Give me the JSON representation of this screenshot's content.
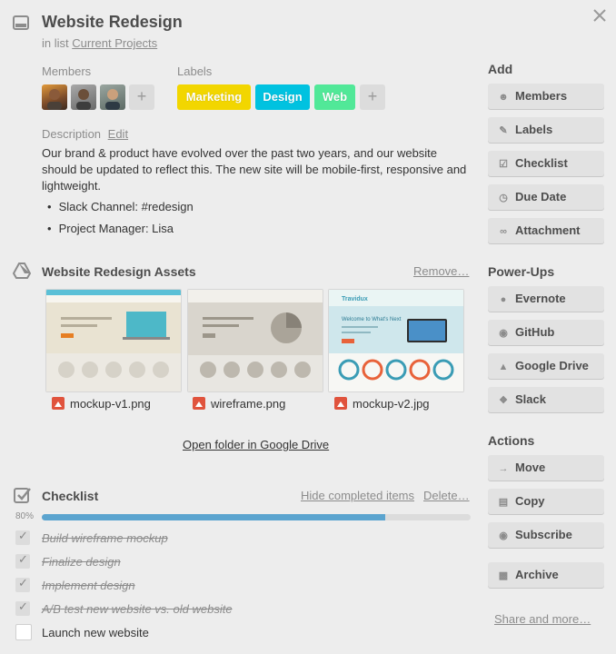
{
  "card": {
    "title": "Website Redesign",
    "in_list_prefix": "in list",
    "list_name": "Current Projects"
  },
  "members": {
    "label": "Members",
    "add": "+"
  },
  "labels": {
    "label": "Labels",
    "add": "+",
    "items": [
      {
        "name": "Marketing",
        "color": "#f2d600"
      },
      {
        "name": "Design",
        "color": "#00c2e0"
      },
      {
        "name": "Web",
        "color": "#51e898"
      }
    ]
  },
  "description": {
    "label": "Description",
    "edit": "Edit",
    "text": "Our brand & product have evolved over the past two years, and our website should be updated to reflect this. The new site will be mobile-first, responsive and lightweight.",
    "bullets": [
      "Slack Channel: #redesign",
      "Project Manager: Lisa"
    ]
  },
  "assets": {
    "title": "Website Redesign Assets",
    "remove": "Remove…",
    "files": [
      "mockup-v1.png",
      "wireframe.png",
      "mockup-v2.jpg"
    ],
    "mockup_v2_brand": "Travidux",
    "mockup_v2_headline": "Welcome to What's Next",
    "open_folder": "Open folder in Google Drive"
  },
  "checklist": {
    "title": "Checklist",
    "hide_completed": "Hide completed items",
    "delete": "Delete…",
    "percent_label": "80%",
    "progress": 0.8,
    "items": [
      {
        "text": "Build wireframe mockup",
        "done": true
      },
      {
        "text": "Finalize design",
        "done": true
      },
      {
        "text": "Implement design",
        "done": true
      },
      {
        "text": "A/B test new website vs. old website",
        "done": true
      },
      {
        "text": "Launch new website",
        "done": false
      }
    ]
  },
  "sidebar": {
    "add_heading": "Add",
    "add": [
      {
        "label": "Members",
        "icon": "person-icon"
      },
      {
        "label": "Labels",
        "icon": "tag-icon"
      },
      {
        "label": "Checklist",
        "icon": "checkbox-icon"
      },
      {
        "label": "Due Date",
        "icon": "clock-icon"
      },
      {
        "label": "Attachment",
        "icon": "paperclip-icon"
      }
    ],
    "powerups_heading": "Power-Ups",
    "powerups": [
      {
        "label": "Evernote",
        "icon": "evernote-icon"
      },
      {
        "label": "GitHub",
        "icon": "github-icon"
      },
      {
        "label": "Google Drive",
        "icon": "google-drive-icon"
      },
      {
        "label": "Slack",
        "icon": "slack-icon"
      }
    ],
    "actions_heading": "Actions",
    "actions": [
      {
        "label": "Move",
        "icon": "arrow-right-icon"
      },
      {
        "label": "Copy",
        "icon": "copy-icon"
      },
      {
        "label": "Subscribe",
        "icon": "eye-icon"
      },
      {
        "label": "Archive",
        "icon": "archive-icon"
      }
    ],
    "share": "Share and more…"
  }
}
